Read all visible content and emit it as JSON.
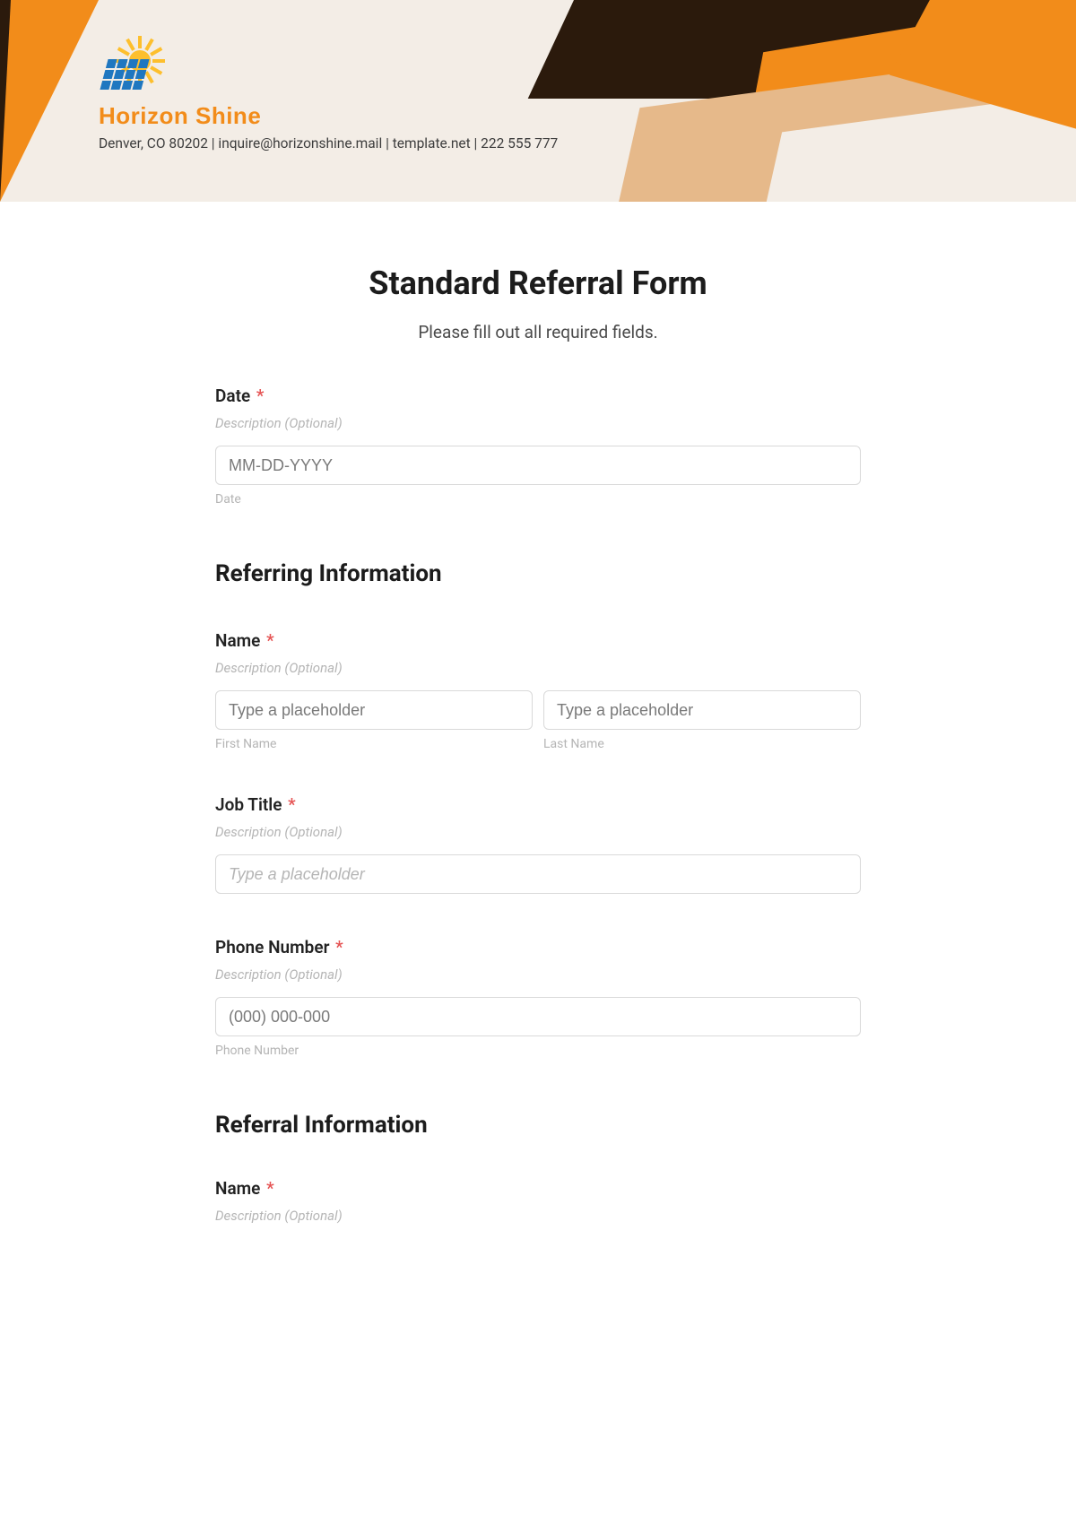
{
  "brand": {
    "name": "Horizon Shine",
    "subline": "Denver, CO 80202 | inquire@horizonshine.mail  | template.net  | 222 555 777"
  },
  "form": {
    "title": "Standard Referral Form",
    "subtitle": "Please fill out all required fields.",
    "date": {
      "label": "Date",
      "desc": "Description (Optional)",
      "placeholder": "MM-DD-YYYY",
      "sublabel": "Date"
    },
    "section_referring": "Referring Information",
    "name": {
      "label": "Name",
      "desc": "Description (Optional)",
      "first_placeholder": "Type a placeholder",
      "last_placeholder": "Type a placeholder",
      "first_sub": "First Name",
      "last_sub": "Last Name"
    },
    "job": {
      "label": "Job Title",
      "desc": "Description (Optional)",
      "placeholder": "Type a placeholder"
    },
    "phone": {
      "label": "Phone Number",
      "desc": "Description (Optional)",
      "placeholder": "(000) 000-000",
      "sublabel": "Phone Number"
    },
    "section_referral": "Referral Information",
    "name2": {
      "label": "Name",
      "desc": "Description (Optional)"
    }
  }
}
